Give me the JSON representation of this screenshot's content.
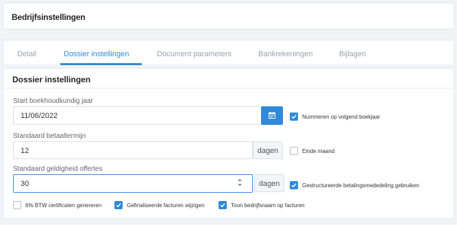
{
  "header": {
    "title": "Bedrijfsinstellingen"
  },
  "tabs": [
    {
      "label": "Detail",
      "active": false
    },
    {
      "label": "Dossier instellingen",
      "active": true
    },
    {
      "label": "Document parameters",
      "active": false
    },
    {
      "label": "Bankrekeningen",
      "active": false
    },
    {
      "label": "Bijlagen",
      "active": false
    }
  ],
  "panel": {
    "title": "Dossier instellingen",
    "start_year": {
      "label": "Start boekhoudkundig jaar",
      "value": "11/06/2022"
    },
    "payment_term": {
      "label": "Standaard betaaltermijn",
      "value": "12",
      "unit": "dagen"
    },
    "quote_validity": {
      "label": "Standaard geldigheid offertes",
      "value": "30",
      "unit": "dagen"
    },
    "checkboxes": {
      "number_next_year": {
        "label": "Nummeren op volgend boekjaar",
        "checked": true
      },
      "end_of_month": {
        "label": "Einde maand",
        "checked": false
      },
      "structured_payment": {
        "label": "Gestructureerde betalingsmededeling gebruiken",
        "checked": true
      },
      "vat_certificates": {
        "label": "6% BTW certificaten genereren",
        "checked": false
      },
      "edit_finalized": {
        "label": "Gefinaliseerde facturen wijzigen",
        "checked": true
      },
      "show_company_name": {
        "label": "Toon bedrijfsnaam op facturen",
        "checked": true
      }
    }
  },
  "colors": {
    "accent": "#2f8ad8",
    "background": "#f1f3f6"
  },
  "icons": {
    "calendar": "calendar-icon",
    "stepper": "stepper-arrows-icon",
    "check": "checkmark-icon"
  }
}
